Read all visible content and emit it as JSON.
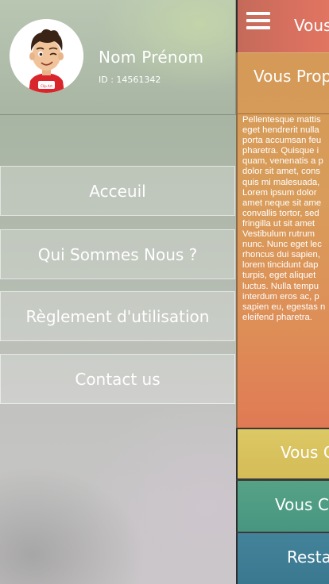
{
  "profile": {
    "name": "Nom Prénom",
    "id_text": "ID : 14561342",
    "avatar_caption": "Clip Art"
  },
  "menu": [
    {
      "label": "Acceuil"
    },
    {
      "label": "Qui Sommes Nous ?"
    },
    {
      "label": "Règlement d'utilisation"
    },
    {
      "label": "Contact us"
    }
  ],
  "content": {
    "topbar_title": "Vous",
    "card_title": "Vous Prop",
    "card_text_lines": [
      "Pellentesque mattis",
      "eget hendrerit nulla",
      "porta accumsan feu",
      "pharetra. Quisque i",
      "quam, venenatis a p",
      "dolor sit amet, cons",
      "quis mi malesuada,",
      "Lorem ipsum dolor",
      "amet neque sit ame",
      "convallis tortor, sed",
      "fringilla ut sit amet",
      "Vestibulum rutrum",
      "nunc. Nunc eget lec",
      "rhoncus dui sapien,",
      "lorem tincidunt dap",
      "turpis, eget aliquet",
      "luctus. Nulla tempu",
      "interdum eros ac, p",
      "sapien eu, egestas n",
      "eleifend pharetra."
    ],
    "tiles": [
      {
        "label": "Vous C",
        "color": "#d9c25f"
      },
      {
        "label": "Vous C",
        "color": "#4e9d82"
      },
      {
        "label": "Resta",
        "color": "#3f7f96"
      }
    ]
  },
  "colors": {
    "topbar": "#d8705f",
    "card": "#d99c5a"
  }
}
